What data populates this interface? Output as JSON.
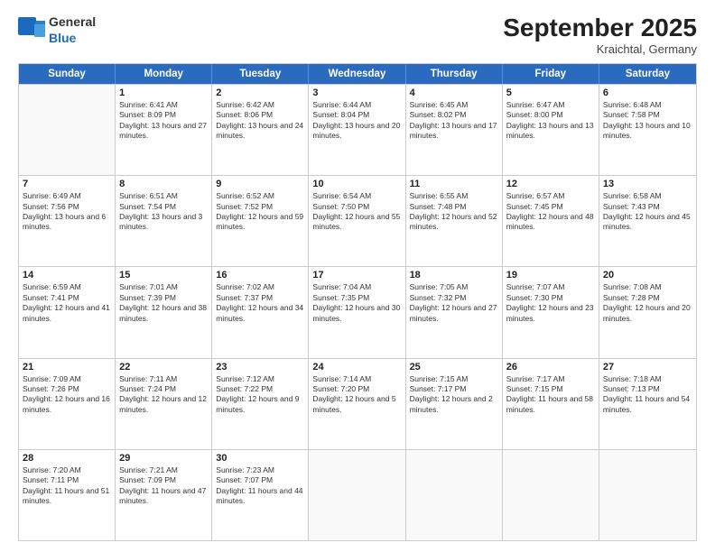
{
  "header": {
    "logo_general": "General",
    "logo_blue": "Blue",
    "month_title": "September 2025",
    "location": "Kraichtal, Germany"
  },
  "days_of_week": [
    "Sunday",
    "Monday",
    "Tuesday",
    "Wednesday",
    "Thursday",
    "Friday",
    "Saturday"
  ],
  "weeks": [
    [
      {
        "day": null
      },
      {
        "day": 1,
        "sunrise": "Sunrise: 6:41 AM",
        "sunset": "Sunset: 8:09 PM",
        "daylight": "Daylight: 13 hours and 27 minutes."
      },
      {
        "day": 2,
        "sunrise": "Sunrise: 6:42 AM",
        "sunset": "Sunset: 8:06 PM",
        "daylight": "Daylight: 13 hours and 24 minutes."
      },
      {
        "day": 3,
        "sunrise": "Sunrise: 6:44 AM",
        "sunset": "Sunset: 8:04 PM",
        "daylight": "Daylight: 13 hours and 20 minutes."
      },
      {
        "day": 4,
        "sunrise": "Sunrise: 6:45 AM",
        "sunset": "Sunset: 8:02 PM",
        "daylight": "Daylight: 13 hours and 17 minutes."
      },
      {
        "day": 5,
        "sunrise": "Sunrise: 6:47 AM",
        "sunset": "Sunset: 8:00 PM",
        "daylight": "Daylight: 13 hours and 13 minutes."
      },
      {
        "day": 6,
        "sunrise": "Sunrise: 6:48 AM",
        "sunset": "Sunset: 7:58 PM",
        "daylight": "Daylight: 13 hours and 10 minutes."
      }
    ],
    [
      {
        "day": 7,
        "sunrise": "Sunrise: 6:49 AM",
        "sunset": "Sunset: 7:56 PM",
        "daylight": "Daylight: 13 hours and 6 minutes."
      },
      {
        "day": 8,
        "sunrise": "Sunrise: 6:51 AM",
        "sunset": "Sunset: 7:54 PM",
        "daylight": "Daylight: 13 hours and 3 minutes."
      },
      {
        "day": 9,
        "sunrise": "Sunrise: 6:52 AM",
        "sunset": "Sunset: 7:52 PM",
        "daylight": "Daylight: 12 hours and 59 minutes."
      },
      {
        "day": 10,
        "sunrise": "Sunrise: 6:54 AM",
        "sunset": "Sunset: 7:50 PM",
        "daylight": "Daylight: 12 hours and 55 minutes."
      },
      {
        "day": 11,
        "sunrise": "Sunrise: 6:55 AM",
        "sunset": "Sunset: 7:48 PM",
        "daylight": "Daylight: 12 hours and 52 minutes."
      },
      {
        "day": 12,
        "sunrise": "Sunrise: 6:57 AM",
        "sunset": "Sunset: 7:45 PM",
        "daylight": "Daylight: 12 hours and 48 minutes."
      },
      {
        "day": 13,
        "sunrise": "Sunrise: 6:58 AM",
        "sunset": "Sunset: 7:43 PM",
        "daylight": "Daylight: 12 hours and 45 minutes."
      }
    ],
    [
      {
        "day": 14,
        "sunrise": "Sunrise: 6:59 AM",
        "sunset": "Sunset: 7:41 PM",
        "daylight": "Daylight: 12 hours and 41 minutes."
      },
      {
        "day": 15,
        "sunrise": "Sunrise: 7:01 AM",
        "sunset": "Sunset: 7:39 PM",
        "daylight": "Daylight: 12 hours and 38 minutes."
      },
      {
        "day": 16,
        "sunrise": "Sunrise: 7:02 AM",
        "sunset": "Sunset: 7:37 PM",
        "daylight": "Daylight: 12 hours and 34 minutes."
      },
      {
        "day": 17,
        "sunrise": "Sunrise: 7:04 AM",
        "sunset": "Sunset: 7:35 PM",
        "daylight": "Daylight: 12 hours and 30 minutes."
      },
      {
        "day": 18,
        "sunrise": "Sunrise: 7:05 AM",
        "sunset": "Sunset: 7:32 PM",
        "daylight": "Daylight: 12 hours and 27 minutes."
      },
      {
        "day": 19,
        "sunrise": "Sunrise: 7:07 AM",
        "sunset": "Sunset: 7:30 PM",
        "daylight": "Daylight: 12 hours and 23 minutes."
      },
      {
        "day": 20,
        "sunrise": "Sunrise: 7:08 AM",
        "sunset": "Sunset: 7:28 PM",
        "daylight": "Daylight: 12 hours and 20 minutes."
      }
    ],
    [
      {
        "day": 21,
        "sunrise": "Sunrise: 7:09 AM",
        "sunset": "Sunset: 7:26 PM",
        "daylight": "Daylight: 12 hours and 16 minutes."
      },
      {
        "day": 22,
        "sunrise": "Sunrise: 7:11 AM",
        "sunset": "Sunset: 7:24 PM",
        "daylight": "Daylight: 12 hours and 12 minutes."
      },
      {
        "day": 23,
        "sunrise": "Sunrise: 7:12 AM",
        "sunset": "Sunset: 7:22 PM",
        "daylight": "Daylight: 12 hours and 9 minutes."
      },
      {
        "day": 24,
        "sunrise": "Sunrise: 7:14 AM",
        "sunset": "Sunset: 7:20 PM",
        "daylight": "Daylight: 12 hours and 5 minutes."
      },
      {
        "day": 25,
        "sunrise": "Sunrise: 7:15 AM",
        "sunset": "Sunset: 7:17 PM",
        "daylight": "Daylight: 12 hours and 2 minutes."
      },
      {
        "day": 26,
        "sunrise": "Sunrise: 7:17 AM",
        "sunset": "Sunset: 7:15 PM",
        "daylight": "Daylight: 11 hours and 58 minutes."
      },
      {
        "day": 27,
        "sunrise": "Sunrise: 7:18 AM",
        "sunset": "Sunset: 7:13 PM",
        "daylight": "Daylight: 11 hours and 54 minutes."
      }
    ],
    [
      {
        "day": 28,
        "sunrise": "Sunrise: 7:20 AM",
        "sunset": "Sunset: 7:11 PM",
        "daylight": "Daylight: 11 hours and 51 minutes."
      },
      {
        "day": 29,
        "sunrise": "Sunrise: 7:21 AM",
        "sunset": "Sunset: 7:09 PM",
        "daylight": "Daylight: 11 hours and 47 minutes."
      },
      {
        "day": 30,
        "sunrise": "Sunrise: 7:23 AM",
        "sunset": "Sunset: 7:07 PM",
        "daylight": "Daylight: 11 hours and 44 minutes."
      },
      {
        "day": null
      },
      {
        "day": null
      },
      {
        "day": null
      },
      {
        "day": null
      }
    ]
  ]
}
